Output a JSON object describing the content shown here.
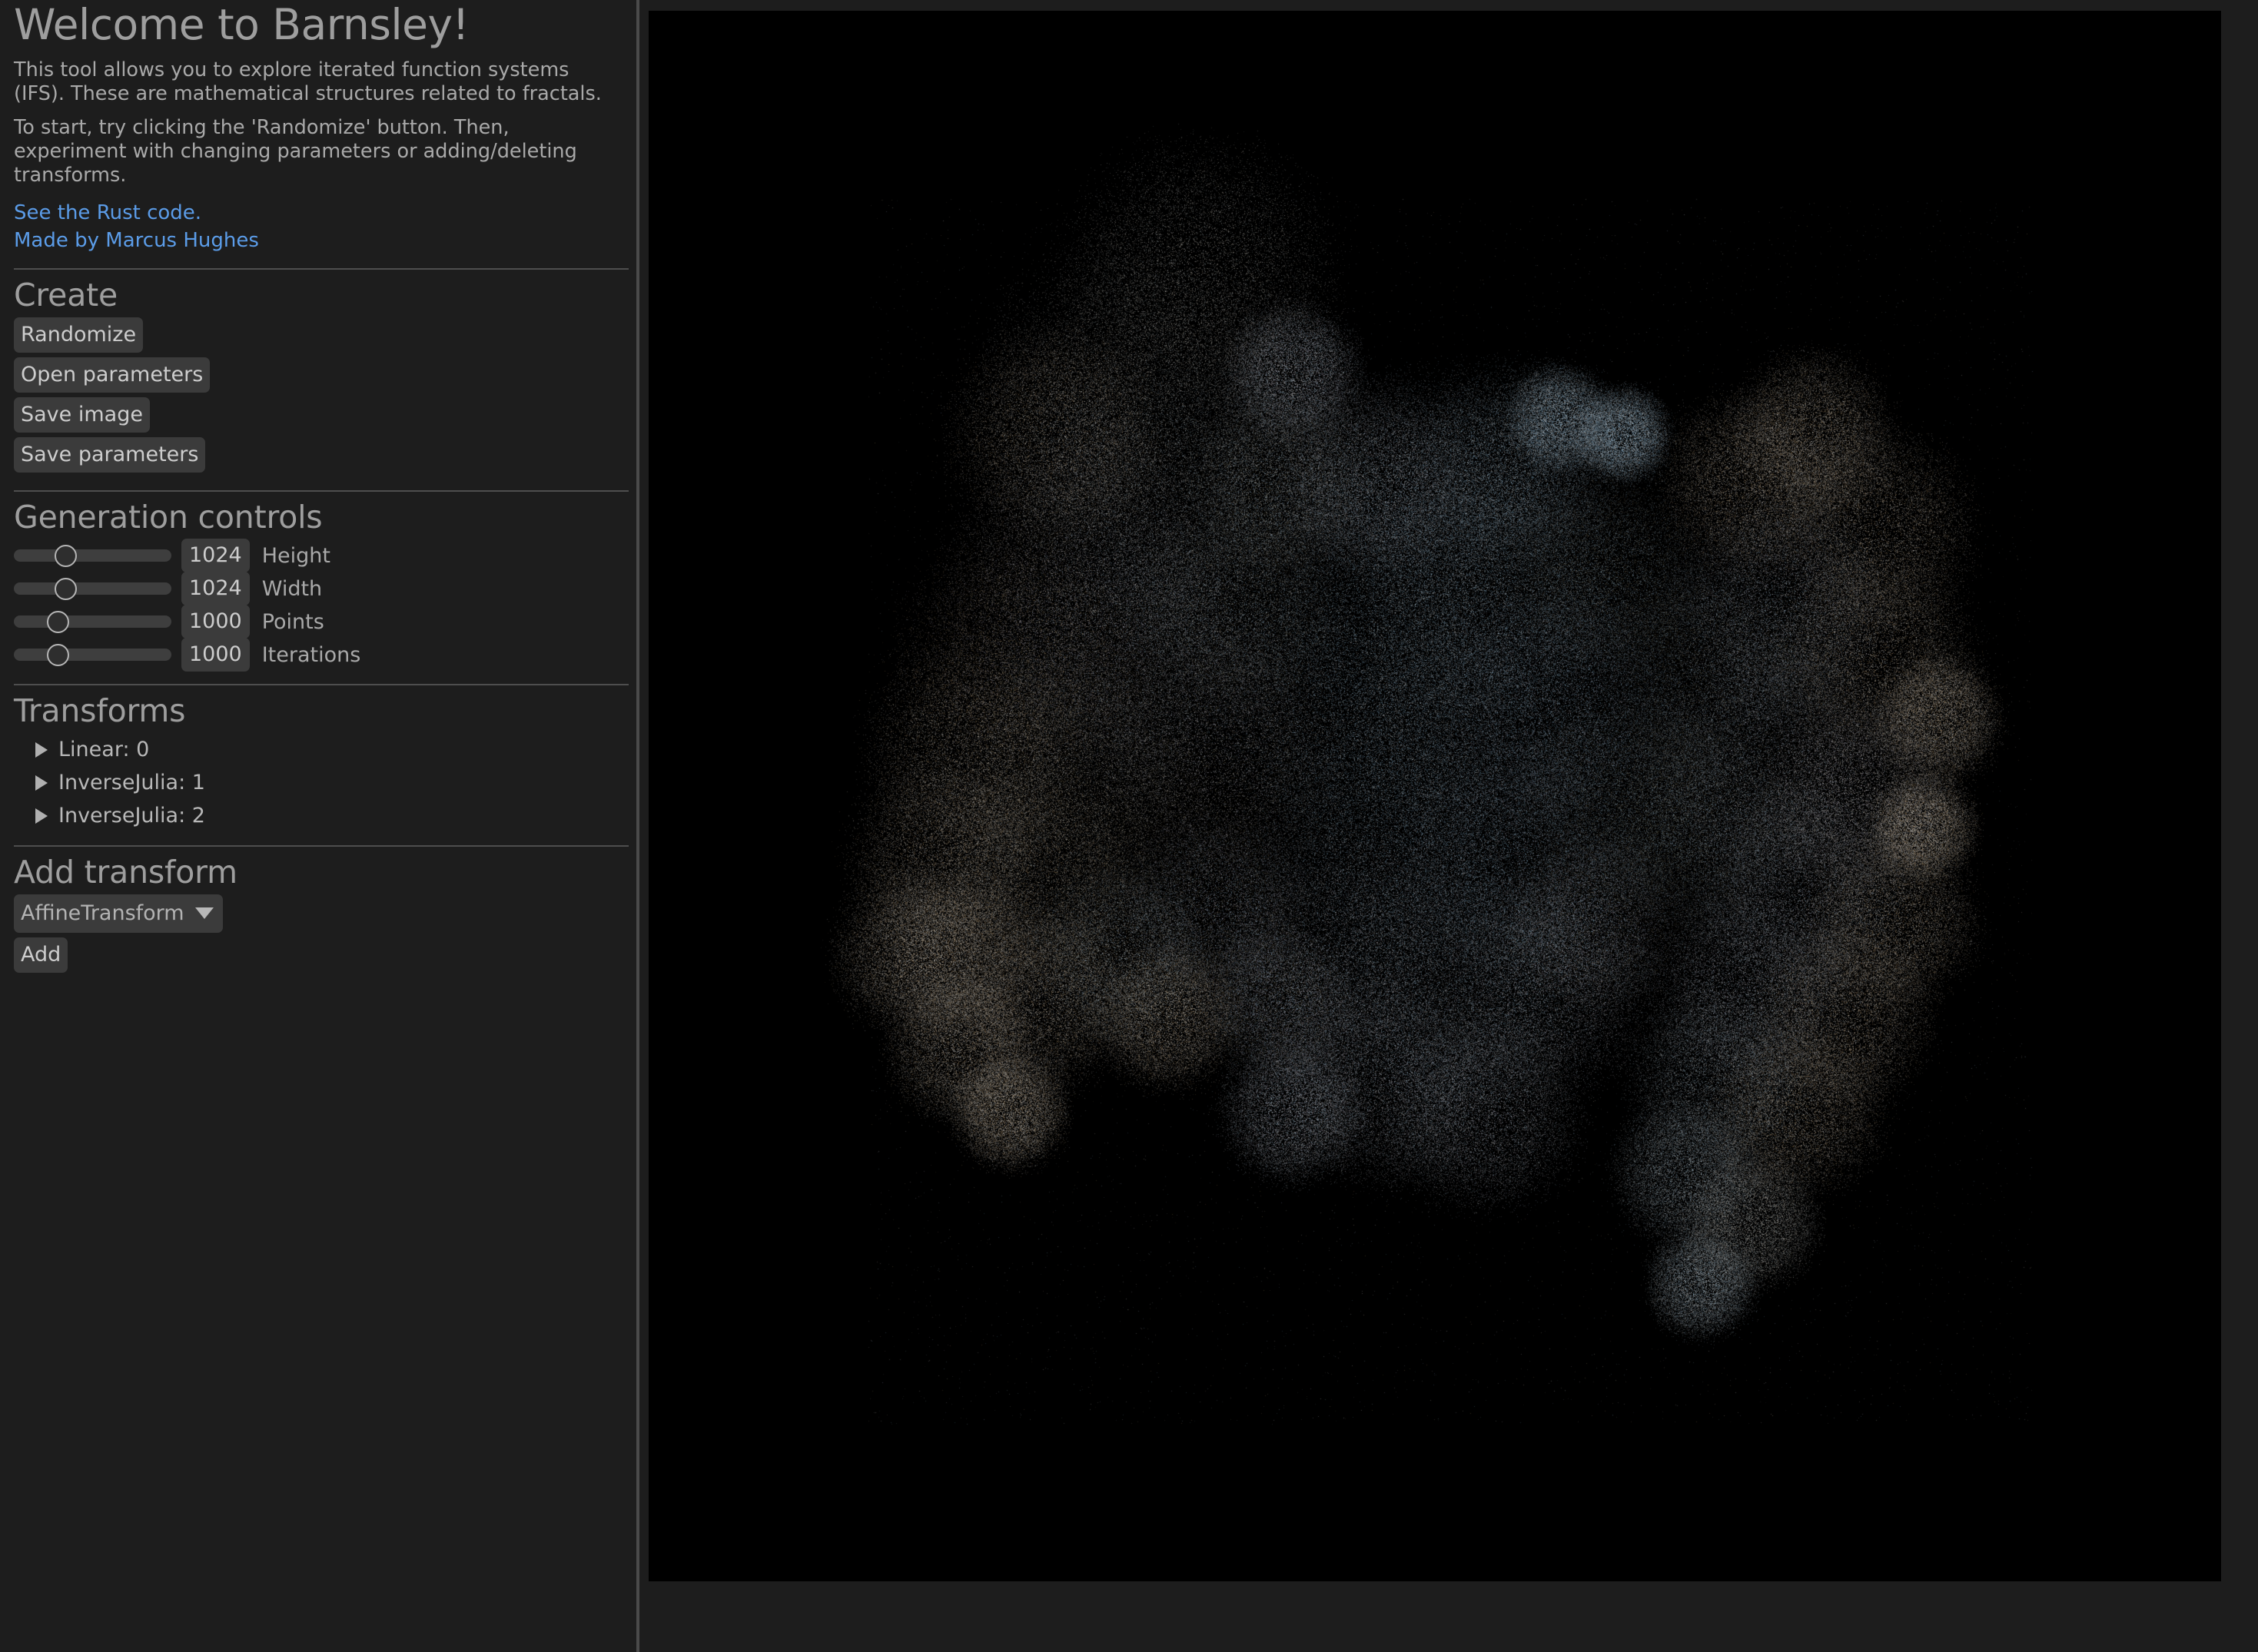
{
  "sidebar": {
    "title": "Welcome to Barnsley!",
    "paragraphs": [
      "This tool allows you to explore iterated function systems (IFS). These are mathematical structures related to fractals.",
      "To start, try clicking the 'Randomize' button. Then, experiment with changing parameters or adding/deleting transforms."
    ],
    "links": [
      {
        "label": "See the Rust code."
      },
      {
        "label": "Made by Marcus Hughes"
      }
    ],
    "create": {
      "heading": "Create",
      "buttons": [
        {
          "label": "Randomize"
        },
        {
          "label": "Open parameters"
        },
        {
          "label": "Save image"
        },
        {
          "label": "Save parameters"
        }
      ]
    },
    "generation_controls": {
      "heading": "Generation controls",
      "sliders": [
        {
          "label": "Height",
          "value": "1024",
          "handle_pct": 29
        },
        {
          "label": "Width",
          "value": "1024",
          "handle_pct": 29
        },
        {
          "label": "Points",
          "value": "1000",
          "handle_pct": 23
        },
        {
          "label": "Iterations",
          "value": "1000",
          "handle_pct": 23
        }
      ]
    },
    "transforms": {
      "heading": "Transforms",
      "items": [
        {
          "label": "Linear: 0",
          "expanded": false
        },
        {
          "label": "InverseJulia: 1",
          "expanded": false
        },
        {
          "label": "InverseJulia: 2",
          "expanded": false
        }
      ]
    },
    "add_transform": {
      "heading": "Add transform",
      "selected_option": "AffineTransform",
      "add_label": "Add"
    }
  },
  "canvas": {
    "background_color": "#000000",
    "description": "Rendered iterated function system fractal attractor",
    "palette": {
      "pale_blue": "#aed0e9",
      "sky_blue": "#93c1e0",
      "cream": "#efe4d2",
      "tan": "#c9a678",
      "khaki": "#8b7f63",
      "lavender": "#c3bcce",
      "white": "#f6f6f4",
      "slate": "#7f8d93"
    }
  },
  "theme": {
    "panel_bg": "#1d1d1d",
    "control_bg": "#3b3b3b",
    "text": "#b8b8b8",
    "heading": "#9e9e9e",
    "link": "#5b9ce8",
    "divider": "#4e4e4e"
  }
}
